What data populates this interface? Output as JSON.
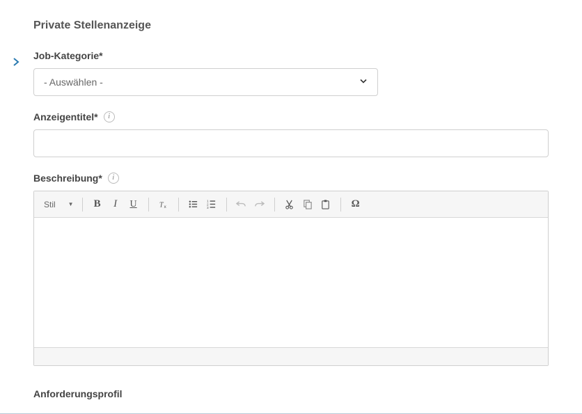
{
  "section": {
    "title": "Private Stellenanzeige"
  },
  "fields": {
    "category": {
      "label": "Job-Kategorie*",
      "selected": "- Auswählen -"
    },
    "title": {
      "label": "Anzeigentitel*",
      "value": ""
    },
    "description": {
      "label": "Beschreibung*"
    },
    "requirements": {
      "label": "Anforderungsprofil"
    }
  },
  "rte": {
    "style_label": "Stil"
  },
  "icons": {
    "info": "i"
  }
}
